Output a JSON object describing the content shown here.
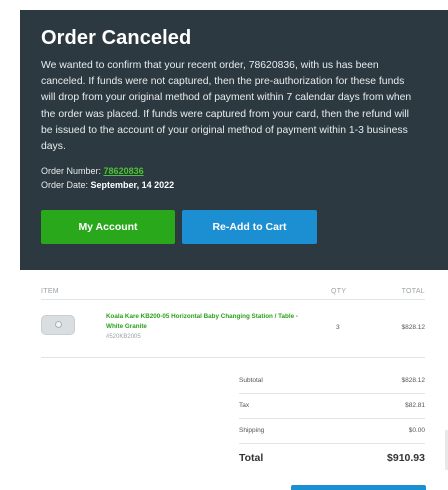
{
  "hero": {
    "title": "Order Canceled",
    "message": "We wanted to confirm that your recent order, 78620836, with us has been canceled. If funds were not captured, then the pre-authorization for these funds will drop from your original method of payment within 7 calendar days from when the order was placed. If funds were captured from your card, then the refund will be issued to the account of your original method of payment within 1-3 business days.",
    "order_number_label": "Order Number:",
    "order_number": "78620836",
    "order_date_label": "Order Date:",
    "order_date": "September, 14 2022",
    "buttons": {
      "my_account": "My Account",
      "readd": "Re-Add to Cart"
    },
    "colors": {
      "background": "#2c3940",
      "my_account": "#29a81c",
      "readd": "#1b8fd2",
      "link": "#4cc335"
    }
  },
  "table": {
    "headers": {
      "item": "ITEM",
      "qty": "QTY",
      "total": "TOTAL"
    },
    "items": [
      {
        "name": "Koala Kare KB200-05 Horizontal Baby Changing Station / Table - White Granite",
        "sku": "#520KB2005",
        "qty": "3",
        "total": "$828.12",
        "icon": "baby-changing-station-image"
      }
    ]
  },
  "summary": {
    "subtotal_label": "Subtotal",
    "subtotal": "$828.12",
    "tax_label": "Tax",
    "tax": "$82.81",
    "shipping_label": "Shipping",
    "shipping": "$0.00",
    "total_label": "Total",
    "total": "$910.93"
  }
}
